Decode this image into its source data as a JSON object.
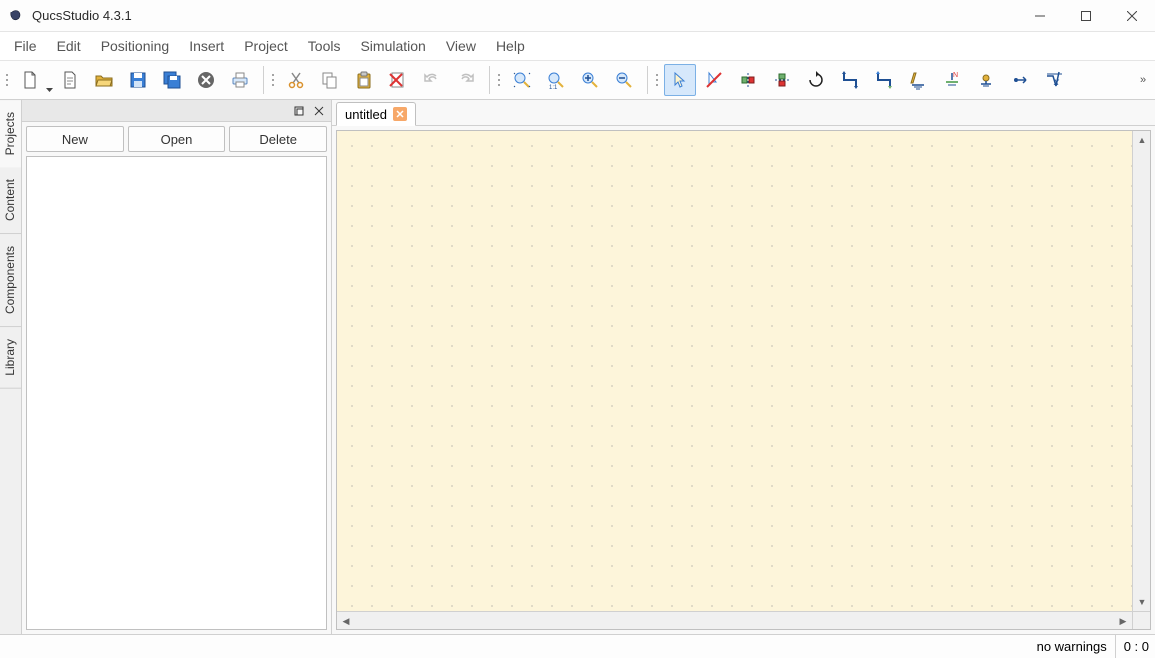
{
  "app": {
    "title": "QucsStudio 4.3.1"
  },
  "menu": {
    "file": "File",
    "edit": "Edit",
    "positioning": "Positioning",
    "insert": "Insert",
    "project": "Project",
    "tools": "Tools",
    "simulation": "Simulation",
    "view": "View",
    "help": "Help"
  },
  "toolbar": {
    "icons": {
      "new": "new-doc-icon",
      "new_text": "new-text-icon",
      "open": "open-folder-icon",
      "save": "save-icon",
      "save_all": "save-all-icon",
      "close": "close-doc-icon",
      "print": "print-icon",
      "cut": "cut-icon",
      "copy": "copy-icon",
      "paste": "paste-icon",
      "delete": "delete-icon",
      "undo": "undo-icon",
      "redo": "redo-icon",
      "zoom_fit": "zoom-fit-icon",
      "zoom_one": "zoom-one-icon",
      "zoom_in": "zoom-in-icon",
      "zoom_out": "zoom-out-icon",
      "select": "select-cursor-icon",
      "deactivate": "deactivate-icon",
      "mirror_h": "mirror-h-icon",
      "mirror_v": "mirror-v-icon",
      "rotate": "rotate-icon",
      "wire": "wire-icon",
      "wire_label": "wire-label-icon",
      "ground": "ground-icon",
      "port": "port-icon",
      "resistor": "resistor-icon",
      "marker": "marker-icon",
      "equation": "equation-icon"
    }
  },
  "sidebar": {
    "tabs": {
      "projects": "Projects",
      "content": "Content",
      "components": "Components",
      "library": "Library"
    },
    "active_tab": "projects",
    "buttons": {
      "new": "New",
      "open": "Open",
      "delete": "Delete"
    },
    "items": []
  },
  "document": {
    "tab_label": "untitled"
  },
  "status": {
    "warnings_label": "no warnings",
    "cursor_pos": "0 : 0"
  },
  "colors": {
    "canvas_bg": "#fdf5da",
    "accent_blue": "#3a7fd5",
    "accent_yellow": "#e3b23c"
  }
}
